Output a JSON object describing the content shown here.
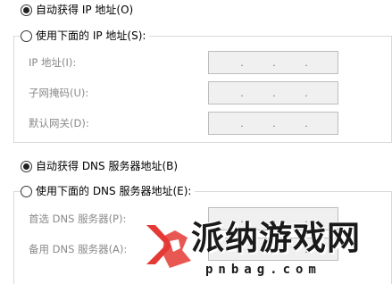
{
  "ip_section": {
    "auto_option_label": "自动获得 IP 地址(O)",
    "auto_selected": true,
    "manual_option_label": "使用下面的 IP 地址(S):",
    "manual_selected": false,
    "fields": [
      {
        "label": "IP 地址(I):",
        "value": ""
      },
      {
        "label": "子网掩码(U):",
        "value": ""
      },
      {
        "label": "默认网关(D):",
        "value": ""
      }
    ]
  },
  "dns_section": {
    "auto_option_label": "自动获得 DNS 服务器地址(B)",
    "auto_selected": true,
    "manual_option_label": "使用下面的 DNS 服务器地址(E):",
    "manual_selected": false,
    "fields": [
      {
        "label": "首选 DNS 服务器(P):",
        "value": ""
      },
      {
        "label": "备用 DNS 服务器(A):",
        "value": ""
      }
    ]
  },
  "ip_separator": ".",
  "watermark": {
    "title": "派纳游戏网",
    "url": "pnbag.com"
  },
  "colors": {
    "disabled_text": "#8a8a8a",
    "field_background": "#f0f0f0",
    "group_border": "#d9d9d9",
    "logo_red": "#e53935"
  }
}
